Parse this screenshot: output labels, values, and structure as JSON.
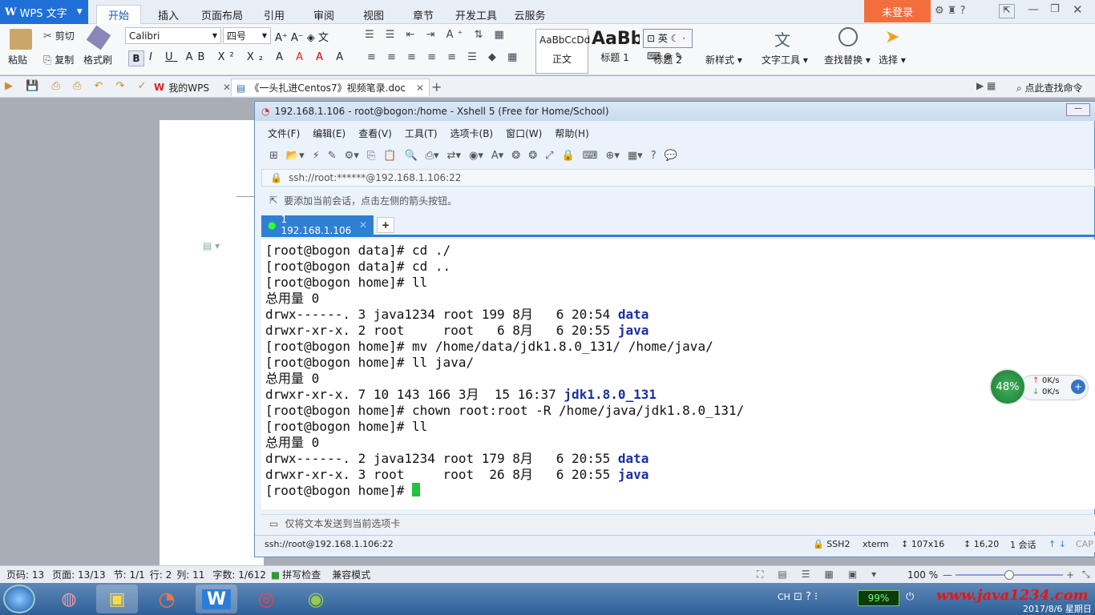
{
  "wps": {
    "app_title": "WPS 文字",
    "login": "未登录",
    "ribbon_tabs": [
      "开始",
      "插入",
      "页面布局",
      "引用",
      "审阅",
      "视图",
      "章节",
      "开发工具",
      "云服务"
    ],
    "active_tab": "开始",
    "clipboard": {
      "paste": "粘贴",
      "cut": "剪切",
      "copy": "复制",
      "format_painter": "格式刷"
    },
    "font_name": "Calibri",
    "font_size": "四号",
    "styles": [
      {
        "preview": "AaBbCcDd",
        "label": "正文"
      },
      {
        "preview": "AaBb",
        "label": "标题 1"
      },
      {
        "preview": "",
        "label": "标题 2"
      }
    ],
    "new_style": "新样式",
    "text_tools": "文字工具",
    "find_replace": "查找替换",
    "select": "选择",
    "doc_tabs": [
      {
        "label": "我的WPS"
      },
      {
        "label": "《一头扎进Centos7》视频笔录.doc"
      }
    ],
    "search_cmd": "点此查找命令",
    "status": {
      "page_code": "页码: 13",
      "page": "页面: 13/13",
      "section": "节: 1/1",
      "row": "行: 2",
      "col": "列: 11",
      "words": "字数: 1/612",
      "spell": "拼写检查",
      "compat": "兼容模式",
      "zoom": "100 %"
    }
  },
  "xshell": {
    "title": "192.168.1.106 - root@bogon:/home - Xshell 5 (Free for Home/School)",
    "menu": [
      "文件(F)",
      "编辑(E)",
      "查看(V)",
      "工具(T)",
      "选项卡(B)",
      "窗口(W)",
      "帮助(H)"
    ],
    "address": "ssh://root:******@192.168.1.106:22",
    "hint": "要添加当前会话，点击左侧的箭头按钮。",
    "tab_label": "1 192.168.1.106",
    "send_hint": "仅将文本发送到当前选项卡",
    "status": {
      "conn": "ssh://root@192.168.1.106:22",
      "proto": "SSH2",
      "term": "xterm",
      "size": "107x16",
      "pos": "16,20",
      "sessions": "1 会话",
      "caps": "CAP"
    },
    "terminal_lines": [
      {
        "text": "[root@bogon data]# cd ./"
      },
      {
        "text": "[root@bogon data]# cd .."
      },
      {
        "text": "[root@bogon home]# ll"
      },
      {
        "text": "总用量 0"
      },
      {
        "text": "drwx------. 3 java1234 root 199 8月   6 20:54 ",
        "dir": "data"
      },
      {
        "text": "drwxr-xr-x. 2 root     root   6 8月   6 20:55 ",
        "dir": "java"
      },
      {
        "text": "[root@bogon home]# mv /home/data/jdk1.8.0_131/ /home/java/"
      },
      {
        "text": "[root@bogon home]# ll java/"
      },
      {
        "text": "总用量 0"
      },
      {
        "text": "drwxr-xr-x. 7 10 143 166 3月  15 16:37 ",
        "dir": "jdk1.8.0_131"
      },
      {
        "text": "[root@bogon home]# chown root:root -R /home/java/jdk1.8.0_131/"
      },
      {
        "text": "[root@bogon home]# ll"
      },
      {
        "text": "总用量 0"
      },
      {
        "text": "drwx------. 2 java1234 root 179 8月   6 20:55 ",
        "dir": "data"
      },
      {
        "text": "drwxr-xr-x. 3 root     root  26 8月   6 20:55 ",
        "dir": "java"
      },
      {
        "text": "[root@bogon home]# ",
        "cursor": true
      }
    ]
  },
  "net_widget": {
    "percent": "48%",
    "up": "0K/s",
    "down": "0K/s"
  },
  "taskbar": {
    "lang": "CH",
    "battery": "99%",
    "watermark": "www.java1234.com",
    "date": "2017/8/6 星期日"
  },
  "colors": {
    "accent": "#2f7fd2",
    "wps_blue": "#1e6fd8",
    "login_orange": "#f36e3c",
    "dir": "#1a2fa0",
    "cursor": "#22c33a"
  }
}
